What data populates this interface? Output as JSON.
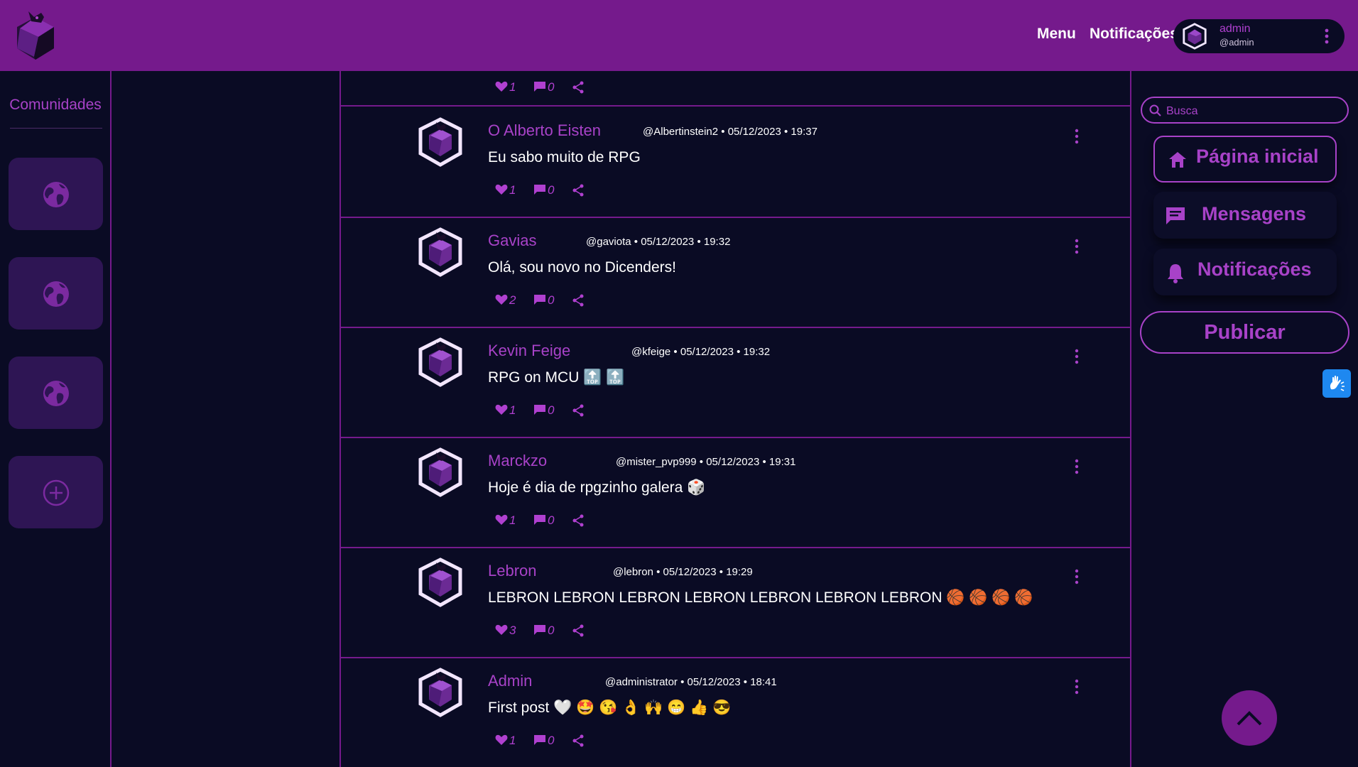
{
  "header": {
    "nav": [
      "Menu",
      "Notificações"
    ],
    "user": {
      "name": "admin",
      "handle": "@admin"
    }
  },
  "sidebar": {
    "title": "Comunidades",
    "cards": [
      "globe-icon",
      "globe-icon",
      "globe-icon",
      "add-icon"
    ]
  },
  "feed": {
    "top_actions": {
      "likes": "1",
      "comments": "0"
    },
    "posts": [
      {
        "author": "O Alberto Eisten",
        "handle": "@Albertinstein2",
        "date": "05/12/2023",
        "time": "19:37",
        "content": "Eu sabo muito de RPG",
        "likes": "1",
        "comments": "0"
      },
      {
        "author": "Gavias",
        "handle": "@gaviota",
        "date": "05/12/2023",
        "time": "19:32",
        "content": "Olá, sou novo no Dicenders!",
        "likes": "2",
        "comments": "0"
      },
      {
        "author": "Kevin Feige",
        "handle": "@kfeige",
        "date": "05/12/2023",
        "time": "19:32",
        "content": "RPG on MCU 🔝 🔝",
        "likes": "1",
        "comments": "0"
      },
      {
        "author": "Marckzo",
        "handle": "@mister_pvp999",
        "date": "05/12/2023",
        "time": "19:31",
        "content": "Hoje é dia de rpgzinho galera 🎲",
        "likes": "1",
        "comments": "0"
      },
      {
        "author": "Lebron",
        "handle": "@lebron",
        "date": "05/12/2023",
        "time": "19:29",
        "content": "LEBRON LEBRON LEBRON LEBRON LEBRON LEBRON LEBRON 🏀 🏀 🏀 🏀",
        "likes": "3",
        "comments": "0"
      },
      {
        "author": "Admin",
        "handle": "@administrator",
        "date": "05/12/2023",
        "time": "18:41",
        "content": "First post 🤍 🤩 😘 👌 🙌 😁 👍 😎",
        "likes": "1",
        "comments": "0"
      }
    ]
  },
  "right": {
    "search_placeholder": "Busca",
    "nav": [
      {
        "label": "Página inicial",
        "icon": "home-icon",
        "active": true
      },
      {
        "label": "Mensagens",
        "icon": "message-icon",
        "active": false
      },
      {
        "label": "Notificações",
        "icon": "bell-icon",
        "active": false
      }
    ],
    "publish": "Publicar"
  },
  "colors": {
    "header": "#751a8c",
    "background": "#0a0b24",
    "accent": "#a842c8",
    "card": "#2e1554",
    "a11y": "#1e88f0"
  }
}
